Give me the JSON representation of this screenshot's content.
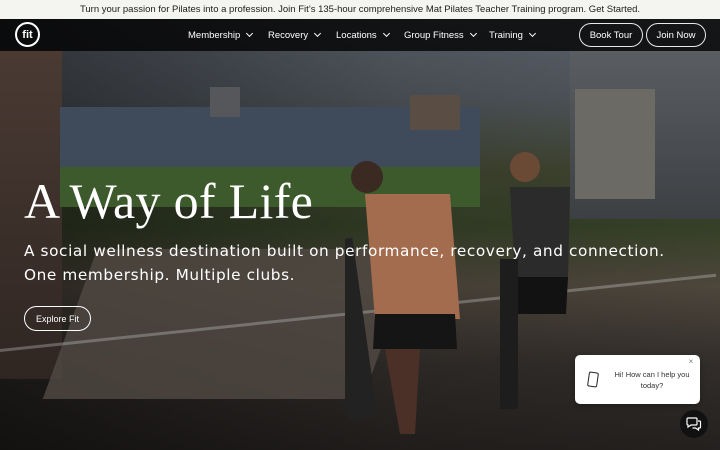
{
  "announcement": {
    "text": "Turn your passion for Pilates into a profession. Join Fit’s 135-hour comprehensive Mat Pilates Teacher Training program. Get Started."
  },
  "nav": {
    "logo_text": "fit",
    "items": [
      {
        "label": "Membership"
      },
      {
        "label": "Recovery"
      },
      {
        "label": "Locations"
      },
      {
        "label": "Group Fitness"
      },
      {
        "label": "Training"
      }
    ],
    "book_tour_label": "Book Tour",
    "join_now_label": "Join Now"
  },
  "hero": {
    "title": "A Way of Life",
    "subtitle_line1": "A social wellness destination built on performance, recovery, and connection.",
    "subtitle_line2": "One membership. Multiple clubs.",
    "cta_label": "Explore Fit"
  },
  "chat": {
    "message": "Hi! How can I help you today?",
    "close_symbol": "×",
    "open_icon": "chat-bubbles-icon",
    "device_icon": "phone-icon"
  },
  "colors": {
    "announcement_bg": "#f4f4f1",
    "nav_bg": "#000000",
    "text_light": "#ffffff"
  }
}
